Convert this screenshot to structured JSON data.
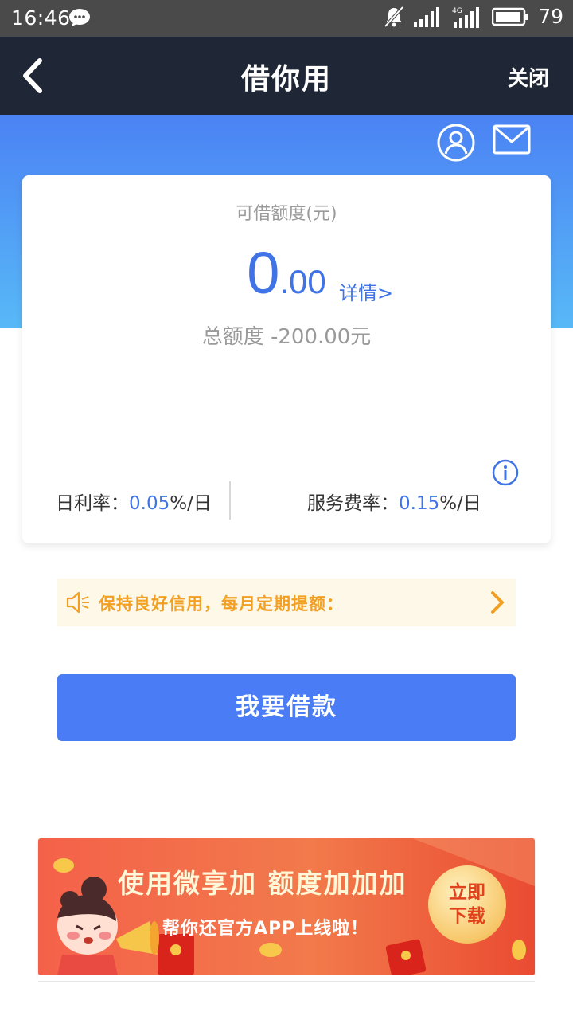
{
  "status_bar": {
    "time": "16:46",
    "battery": "79",
    "network": "4G"
  },
  "nav": {
    "back_icon": "chevron-left-icon",
    "title": "借你用",
    "close_label": "关闭"
  },
  "header_icons": [
    "user-icon",
    "mail-icon"
  ],
  "card": {
    "credit_label": "可借额度(元)",
    "amount_int": "0",
    "amount_dec": ".00",
    "details_link": "详情>",
    "total_limit": "总额度 -200.00元",
    "daily_rate_label": "日利率：",
    "daily_rate_value": "0.05",
    "daily_rate_unit": "%/日",
    "service_rate_label": "服务费率：",
    "service_rate_value": "0.15",
    "service_rate_unit": "%/日"
  },
  "notice": {
    "text": "保持良好信用，每月定期提额："
  },
  "borrow_button": {
    "label": "我要借款"
  },
  "banner": {
    "title": "使用微享加   额度加加加",
    "subtitle": "帮你还官方APP上线啦！",
    "download_line1": "立即",
    "download_line2": "下载"
  },
  "colors": {
    "primary": "#4a7cf6",
    "nav_bg": "#1f2736",
    "notice_text": "#f2a024",
    "banner": "#f4614a"
  }
}
